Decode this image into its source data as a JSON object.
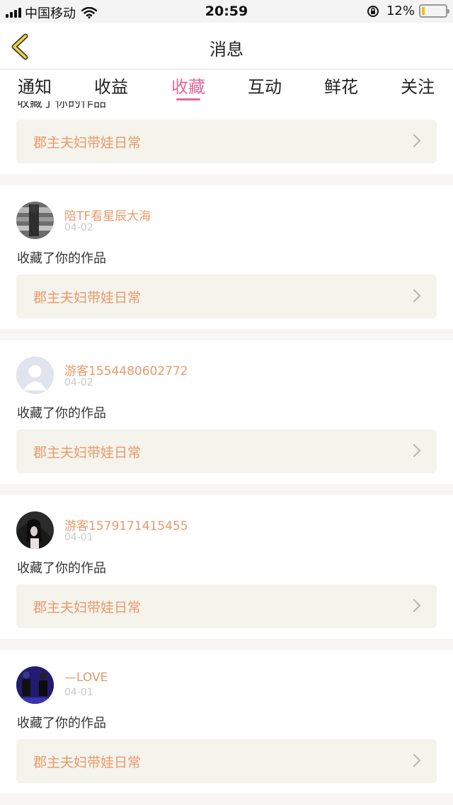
{
  "status_bar": {
    "carrier": "中国移动",
    "time": "20:59",
    "battery": "12%",
    "battery_level": 0.12,
    "icons": [
      "signal-icon",
      "wifi-icon",
      "orientation-lock-icon",
      "battery-icon"
    ]
  },
  "nav": {
    "title": "消息",
    "back_icon": "chevron-left-icon"
  },
  "tabs": [
    {
      "label": "通知",
      "active": false
    },
    {
      "label": "收益",
      "active": false
    },
    {
      "label": "收藏",
      "active": true
    },
    {
      "label": "互动",
      "active": false
    },
    {
      "label": "鲜花",
      "active": false
    },
    {
      "label": "关注",
      "active": false
    }
  ],
  "colors": {
    "accent": "#e2689d",
    "username": "#e89a6a",
    "card_bg": "#f4f3ec"
  },
  "partial_item": {
    "action": "收藏了你的作品",
    "work_title": "郡主夫妇带娃日常"
  },
  "items": [
    {
      "username": "陪TF看星辰大海",
      "date": "04-02",
      "action": "收藏了你的作品",
      "work_title": "郡主夫妇带娃日常",
      "avatar": "photo-avatar"
    },
    {
      "username": "游客1554480602772",
      "date": "04-02",
      "action": "收藏了你的作品",
      "work_title": "郡主夫妇带娃日常",
      "avatar": "default-avatar"
    },
    {
      "username": "游客1579171415455",
      "date": "04-01",
      "action": "收藏了你的作品",
      "work_title": "郡主夫妇带娃日常",
      "avatar": "photo-avatar"
    },
    {
      "username": "—LOVE",
      "date": "04-01",
      "action": "收藏了你的作品",
      "work_title": "郡主夫妇带娃日常",
      "avatar": "photo-avatar"
    }
  ]
}
